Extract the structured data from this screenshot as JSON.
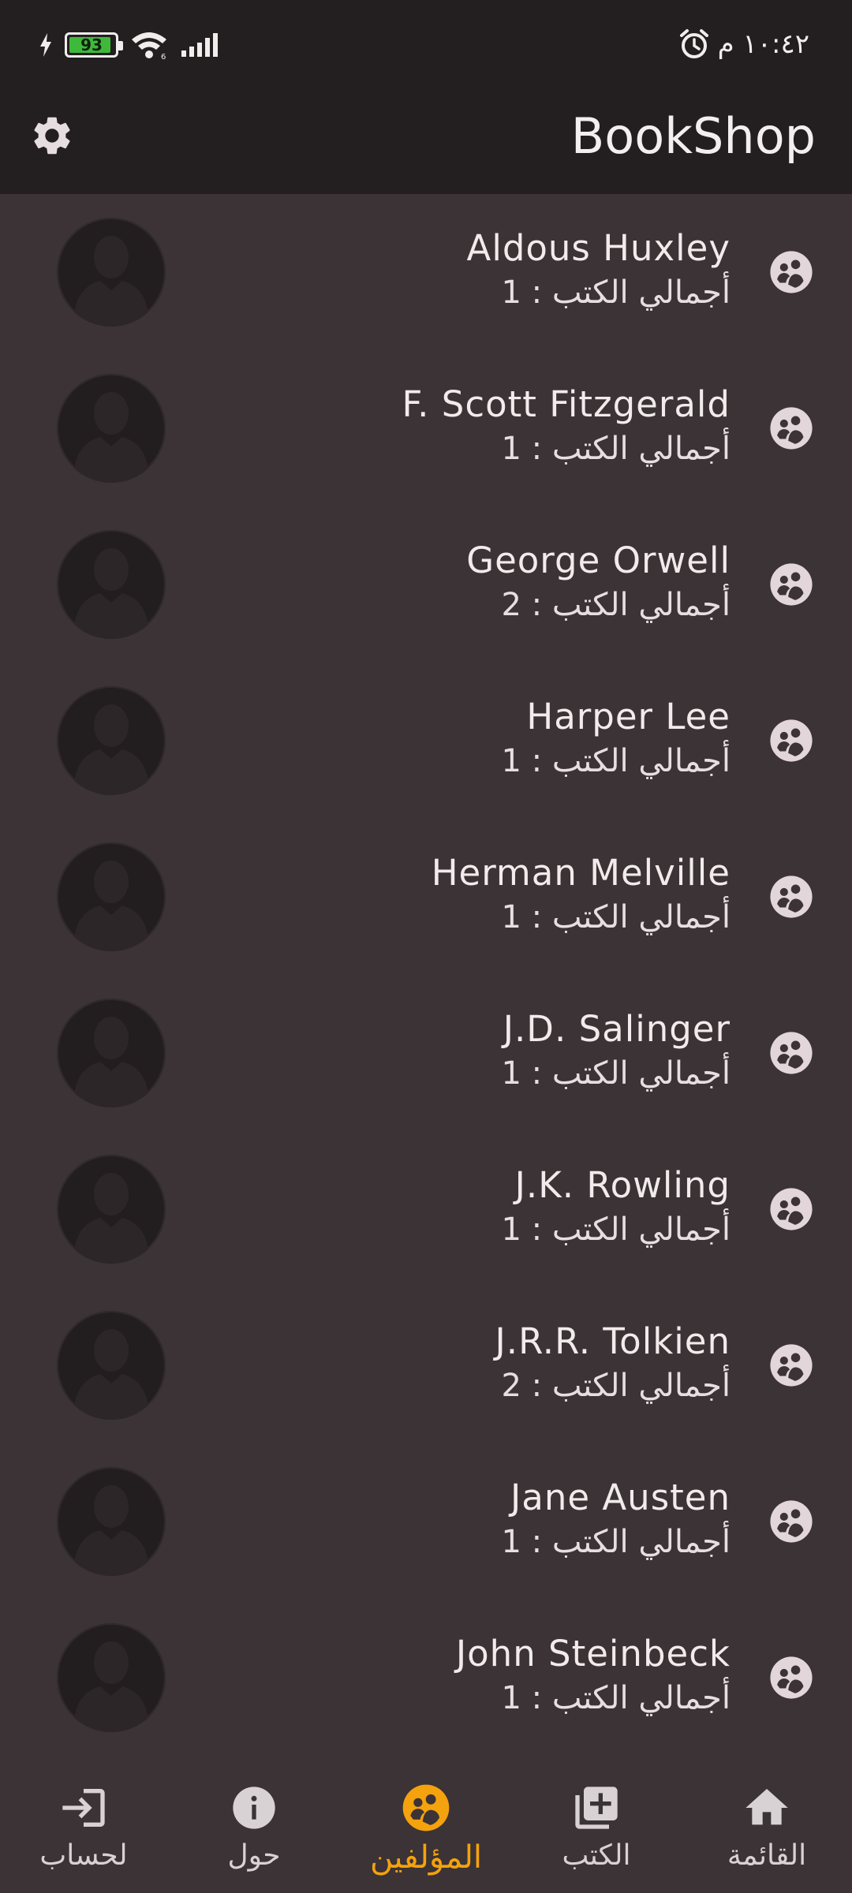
{
  "status_bar": {
    "battery_level": 93,
    "battery_label": "93",
    "time": "١٠:٤٢ م"
  },
  "app_bar": {
    "title": "BookShop",
    "settings_icon": "gear-icon"
  },
  "authors": [
    {
      "name": "Aldous Huxley",
      "count_label": "أجمالي الكتب : 1"
    },
    {
      "name": "F. Scott Fitzgerald",
      "count_label": "أجمالي الكتب : 1"
    },
    {
      "name": "George Orwell",
      "count_label": "أجمالي الكتب : 2"
    },
    {
      "name": "Harper Lee",
      "count_label": "أجمالي الكتب : 1"
    },
    {
      "name": "Herman Melville",
      "count_label": "أجمالي الكتب : 1"
    },
    {
      "name": "J.D. Salinger",
      "count_label": "أجمالي الكتب : 1"
    },
    {
      "name": "J.K. Rowling",
      "count_label": "أجمالي الكتب : 1"
    },
    {
      "name": "J.R.R. Tolkien",
      "count_label": "أجمالي الكتب : 2"
    },
    {
      "name": "Jane Austen",
      "count_label": "أجمالي الكتب : 1"
    },
    {
      "name": "John Steinbeck",
      "count_label": "أجمالي الكتب : 1"
    }
  ],
  "bottom_nav": {
    "items": [
      {
        "label": "لحساب",
        "icon": "login-icon",
        "active": false
      },
      {
        "label": "حول",
        "icon": "info-icon",
        "active": false
      },
      {
        "label": "المؤلفين",
        "icon": "authors-icon",
        "active": true
      },
      {
        "label": "الكتب",
        "icon": "add-book-icon",
        "active": false
      },
      {
        "label": "القائمة",
        "icon": "home-icon",
        "active": false
      }
    ]
  },
  "colors": {
    "background": "#3b3335",
    "app_bar": "#231e1f",
    "accent": "#f4a20d",
    "icon": "#e2d6da"
  }
}
